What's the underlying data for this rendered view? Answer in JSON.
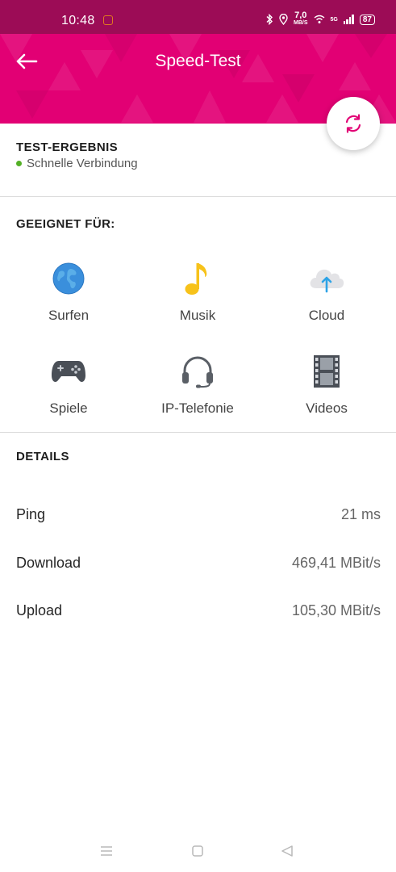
{
  "status_bar": {
    "time": "10:48",
    "speed_value": "7,0",
    "speed_unit": "MB/S",
    "network": "5G",
    "battery": "87"
  },
  "header": {
    "title": "Speed-Test",
    "accent_color": "#e20074"
  },
  "result": {
    "title": "TEST-ERGEBNIS",
    "status": "Schnelle Verbindung",
    "status_color": "#54b026"
  },
  "suitable": {
    "title": "GEEIGNET FÜR:",
    "items": [
      {
        "label": "Surfen",
        "icon": "globe-icon"
      },
      {
        "label": "Musik",
        "icon": "music-note-icon"
      },
      {
        "label": "Cloud",
        "icon": "cloud-upload-icon"
      },
      {
        "label": "Spiele",
        "icon": "gamepad-icon"
      },
      {
        "label": "IP-Telefonie",
        "icon": "headset-icon"
      },
      {
        "label": "Videos",
        "icon": "film-icon"
      }
    ]
  },
  "details": {
    "title": "DETAILS",
    "rows": [
      {
        "label": "Ping",
        "value": "21 ms"
      },
      {
        "label": "Download",
        "value": "469,41 MBit/s"
      },
      {
        "label": "Upload",
        "value": "105,30 MBit/s"
      }
    ]
  }
}
